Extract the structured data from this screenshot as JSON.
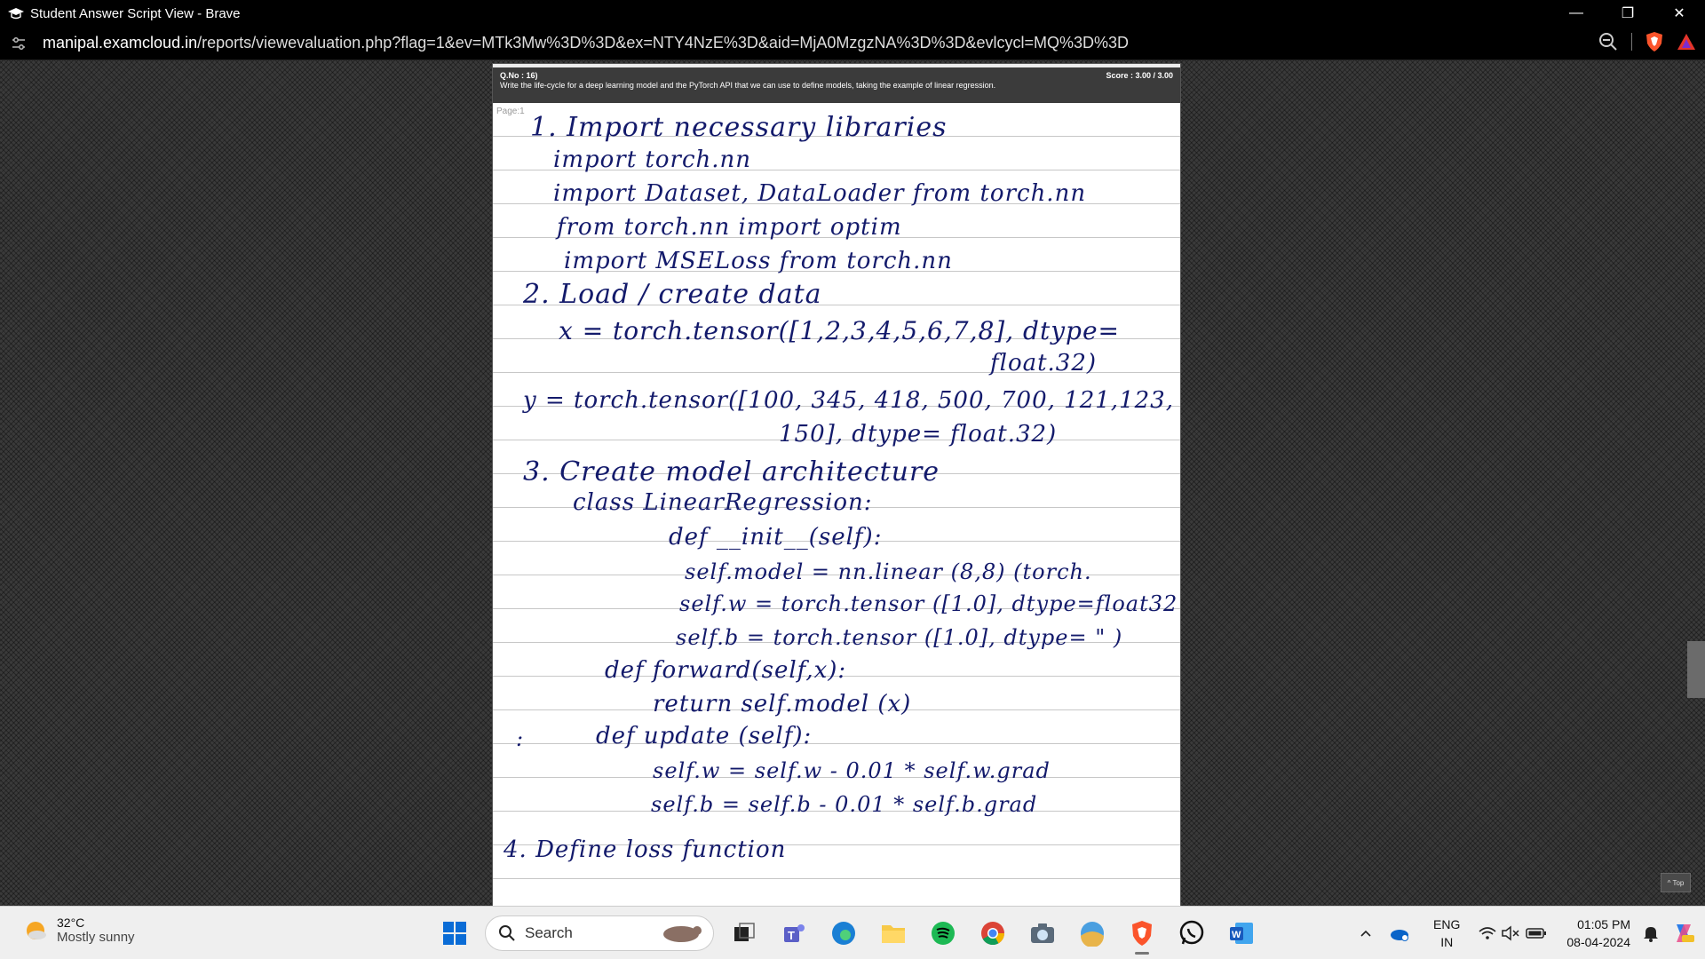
{
  "window": {
    "title": "Student Answer Script View - Brave",
    "controls": {
      "minimize": "—",
      "restore": "❐",
      "close": "✕"
    }
  },
  "address_bar": {
    "host": "manipal.examcloud.in",
    "path": "/reports/viewevaluation.php?flag=1&ev=MTk3Mw%3D%3D&ex=NTY4NzE%3D&aid=MjA0MzgzNA%3D%3D&evlcycl=MQ%3D%3D"
  },
  "question": {
    "number": "Q.No : 16)",
    "text": "Write the life-cycle for a deep learning model and the PyTorch API that we can use to define models, taking the example of linear regression.",
    "score": "Score : 3.00 / 3.00"
  },
  "answer": {
    "page_label": "Page:1",
    "lines": [
      "1. Import necessary libraries",
      "import torch.nn",
      "import Dataset, DataLoader from torch.nn",
      "from torch.nn import optim",
      "import MSELoss from torch.nn",
      "2. Load / create data",
      "x = torch.tensor([1,2,3,4,5,6,7,8], dtype=",
      "float.32)",
      "y = torch.tensor([100, 345, 418, 500, 700, 121,123,",
      "150], dtype= float.32)",
      "3. Create model architecture",
      "class LinearRegression:",
      "def __init__(self):",
      "self.model = nn.linear (8,8) (torch.",
      "self.w = torch.tensor ([1.0], dtype=float32",
      "self.b = torch.tensor ([1.0], dtype= \" )",
      "def forward(self,x):",
      "return self.model (x)",
      ":",
      "def update (self):",
      "self.w = self.w - 0.01 * self.w.grad",
      "self.b = self.b - 0.01 * self.b.grad",
      "4. Define loss function"
    ]
  },
  "top_button": "^ Top",
  "taskbar": {
    "weather_temp": "32°C",
    "weather_condition": "Mostly sunny",
    "search_placeholder": "Search",
    "language": "ENG",
    "region": "IN",
    "time": "01:05 PM",
    "date": "08-04-2024"
  }
}
